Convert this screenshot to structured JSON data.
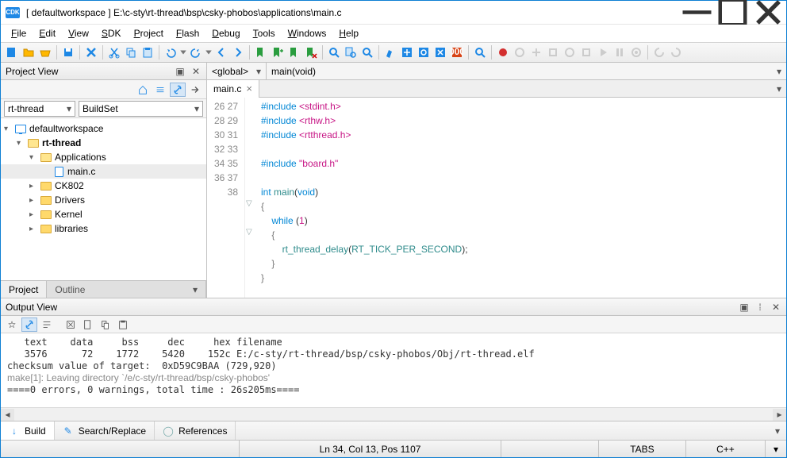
{
  "window": {
    "icon_text": "CDK",
    "title": "[ defaultworkspace ] E:\\c-sty\\rt-thread\\bsp\\csky-phobos\\applications\\main.c"
  },
  "menu": [
    "File",
    "Edit",
    "View",
    "SDK",
    "Project",
    "Flash",
    "Debug",
    "Tools",
    "Windows",
    "Help"
  ],
  "project_view": {
    "title": "Project View",
    "combo1": "rt-thread",
    "combo2": "BuildSet",
    "tree": {
      "root": "defaultworkspace",
      "project": "rt-thread",
      "folders": [
        {
          "name": "Applications",
          "open": true,
          "children": [
            {
              "name": "main.c",
              "selected": true
            }
          ]
        },
        {
          "name": "CK802"
        },
        {
          "name": "Drivers"
        },
        {
          "name": "Kernel"
        },
        {
          "name": "libraries"
        }
      ]
    },
    "bottom_tabs": [
      "Project",
      "Outline"
    ]
  },
  "editor": {
    "scope": "<global>",
    "func": "main(void)",
    "tab": "main.c",
    "lines": [
      {
        "n": 26,
        "html": "<span class='kw-inc'>#include</span> <span class='kw-str'>&lt;stdint.h&gt;</span>"
      },
      {
        "n": 27,
        "html": "<span class='kw-inc'>#include</span> <span class='kw-str'>&lt;rthw.h&gt;</span>"
      },
      {
        "n": 28,
        "html": "<span class='kw-inc'>#include</span> <span class='kw-str'>&lt;rtthread.h&gt;</span>"
      },
      {
        "n": 29,
        "html": ""
      },
      {
        "n": 30,
        "html": "<span class='kw-inc'>#include</span> <span class='kw-str'>\"board.h\"</span>"
      },
      {
        "n": 31,
        "html": ""
      },
      {
        "n": 32,
        "html": "<span class='kw-type'>int</span> <span class='kw-func'>main</span><span class='punct'>(</span><span class='kw-type'>void</span><span class='punct'>)</span>"
      },
      {
        "n": 33,
        "html": "<span class='brace'>{</span>",
        "fold": true
      },
      {
        "n": 34,
        "html": "    <span class='kw-type'>while</span> <span class='punct'>(</span><span class='kw-num'>1</span><span class='punct'>)</span>"
      },
      {
        "n": 35,
        "html": "    <span class='brace'>{</span>",
        "fold": true
      },
      {
        "n": 36,
        "html": "        <span class='kw-id'>rt_thread_delay</span><span class='punct'>(</span><span class='kw-id'>RT_TICK_PER_SECOND</span><span class='punct'>);</span>"
      },
      {
        "n": 37,
        "html": "    <span class='brace'>}</span>"
      },
      {
        "n": 38,
        "html": "<span class='brace'>}</span>"
      }
    ]
  },
  "output": {
    "title": "Output View",
    "lines": [
      "   text\t   data\t    bss\t    dec\t    hex\tfilename",
      "   3576\t     72\t   1772\t   5420\t   152c\tE:/c-sty/rt-thread/bsp/csky-phobos/Obj/rt-thread.elf",
      "checksum value of target:  0xD59C9BAA (729,920)"
    ],
    "gray_lines": [
      "make[1]: Leaving directory `/e/c-sty/rt-thread/bsp/csky-phobos'"
    ],
    "tail": "====0 errors, 0 warnings, total time : 26s205ms===="
  },
  "bottom": [
    {
      "icon": "↓",
      "label": "Build",
      "color": "#1e88e5",
      "active": true
    },
    {
      "icon": "✎",
      "label": "Search/Replace",
      "color": "#1e88e5"
    },
    {
      "icon": "◯",
      "label": "References",
      "color": "#7aa"
    }
  ],
  "status": {
    "pos": "Ln 34, Col 13, Pos 1107",
    "tabs": "TABS",
    "lang": "C++"
  }
}
